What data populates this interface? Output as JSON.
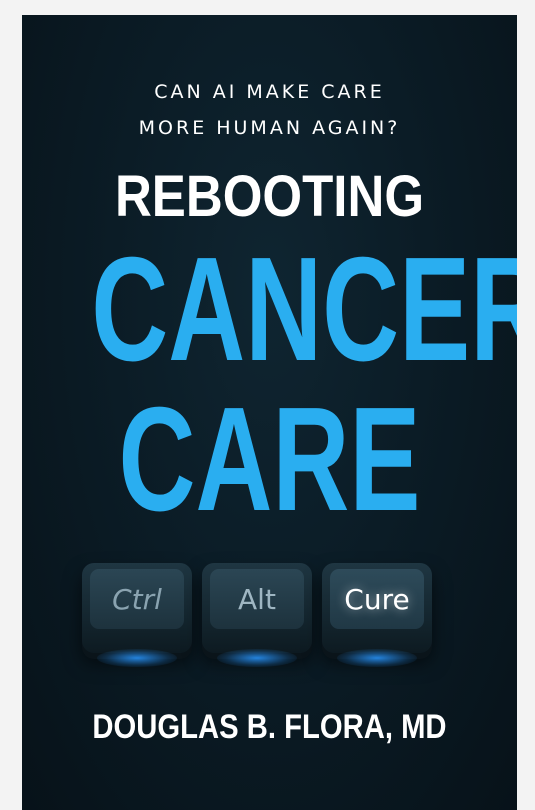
{
  "cover": {
    "tagline_line1": "CAN AI MAKE CARE",
    "tagline_line2": "MORE HUMAN AGAIN?",
    "title_line1": "REBOOTING",
    "title_line2": "CANCER",
    "title_line3": "CARE",
    "keys": [
      {
        "label": "Ctrl"
      },
      {
        "label": "Alt"
      },
      {
        "label": "Cure"
      }
    ],
    "author": "DOUGLAS B. FLORA, MD"
  },
  "colors": {
    "background": "#0b1c26",
    "accent": "#2aaef0",
    "text": "#ffffff",
    "key_glow": "#2896ff"
  }
}
